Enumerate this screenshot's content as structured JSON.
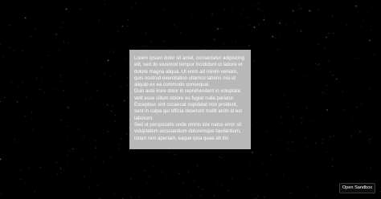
{
  "card": {
    "paragraphs": [
      "Lorem ipsum dolor sit amet, consectetur adipiscing elit, sed do eiusmod tempor incididunt ut labore et dolore magna aliqua. Ut enim ad minim veniam, quis nostrud exercitation ullamco laboris nisi ut aliquip ex ea commodo consequat.",
      "Duis aute irure dolor in reprehenderit in voluptate velit esse cillum dolore eu fugiat nulla pariatur. Excepteur sint occaecat cupidatat non proident, sunt in culpa qui officia deserunt mollit anim id est laborum.",
      "Sed ut perspiciatis unde omnis iste natus error sit voluptatem accusantium doloremque laudantium, totam rem aperiam, eaque ipsa quae ab illo"
    ]
  },
  "footer": {
    "open_sandbox_label": "Open Sandbox"
  },
  "colors": {
    "background": "#000000",
    "card": "#b8b8b8",
    "card_text": "#ffffff"
  }
}
